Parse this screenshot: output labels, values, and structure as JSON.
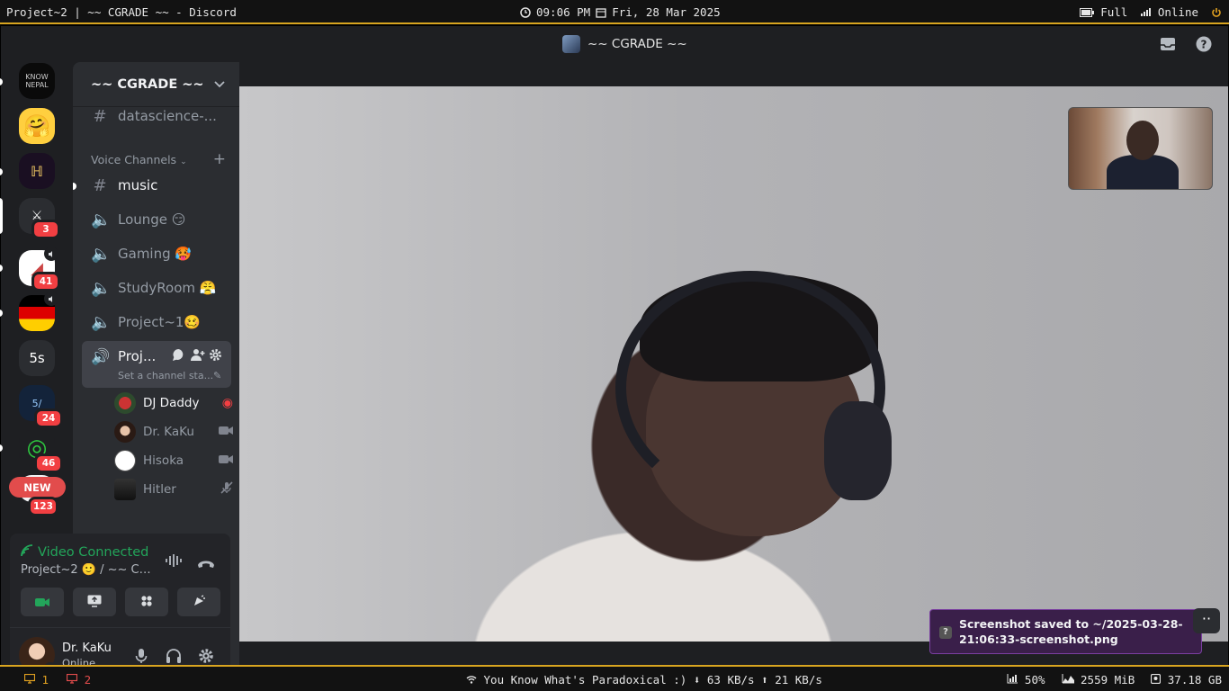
{
  "topbar": {
    "window_title": "Project~2  | ~~ CGRADE ~~ - Discord",
    "clock": "09:06 PM",
    "date": "Fri, 28 Mar 2025",
    "battery": "Full",
    "network": "Online"
  },
  "titlebar": {
    "title": "~~ CGRADE ~~"
  },
  "rail": {
    "servers": [
      {
        "name": "KNOW NEPAL"
      },
      {
        "name": "hugging-face"
      },
      {
        "name": "server-3"
      },
      {
        "name": "server-4",
        "badge": "3"
      },
      {
        "name": "server-5",
        "badge": "41"
      },
      {
        "name": "server-6"
      },
      {
        "name": "5s",
        "label": "5s"
      },
      {
        "name": "server-8",
        "badge": "24"
      },
      {
        "name": "server-9",
        "badge": "46"
      },
      {
        "name": "server-10",
        "badge": "123"
      }
    ],
    "new_label": "NEW"
  },
  "sidebar": {
    "server_name": "~~ CGRADE ~~",
    "top_channel": "datascience-...",
    "category": "Voice Channels",
    "channels": [
      {
        "name": "music"
      },
      {
        "name": "Lounge 😏"
      },
      {
        "name": "Gaming 🥵"
      },
      {
        "name": "StudyRoom 😤"
      },
      {
        "name": "Project~1🥴"
      }
    ],
    "active_channel": {
      "name": "Proj...",
      "status_placeholder": "Set a channel sta..."
    },
    "voice_users": [
      {
        "name": "DJ Daddy"
      },
      {
        "name": "Dr. KaKu"
      },
      {
        "name": "Hisoka"
      },
      {
        "name": "Hitler"
      }
    ]
  },
  "voice_panel": {
    "status": "Video Connected",
    "subtitle": "Project~2 🙂 / ~~ CG..."
  },
  "user": {
    "name": "Dr. KaKu",
    "status": "Online"
  },
  "toast": {
    "text": "Screenshot saved to ~/2025-03-28-21:06:33-screenshot.png"
  },
  "bottombar": {
    "ws_1": "1",
    "ws_2": "2",
    "now_playing": "You Know What's Paradoxical :)",
    "down": "63 KB/s",
    "up": "21 KB/s",
    "cpu": "50%",
    "mem": "2559 MiB",
    "disk": "37.18 GB"
  },
  "colors": {
    "accent_bar": "#d9a520",
    "voice_green": "#23a55a",
    "badge_red": "#f23f42",
    "toast_bg": "#3a1f4a"
  }
}
